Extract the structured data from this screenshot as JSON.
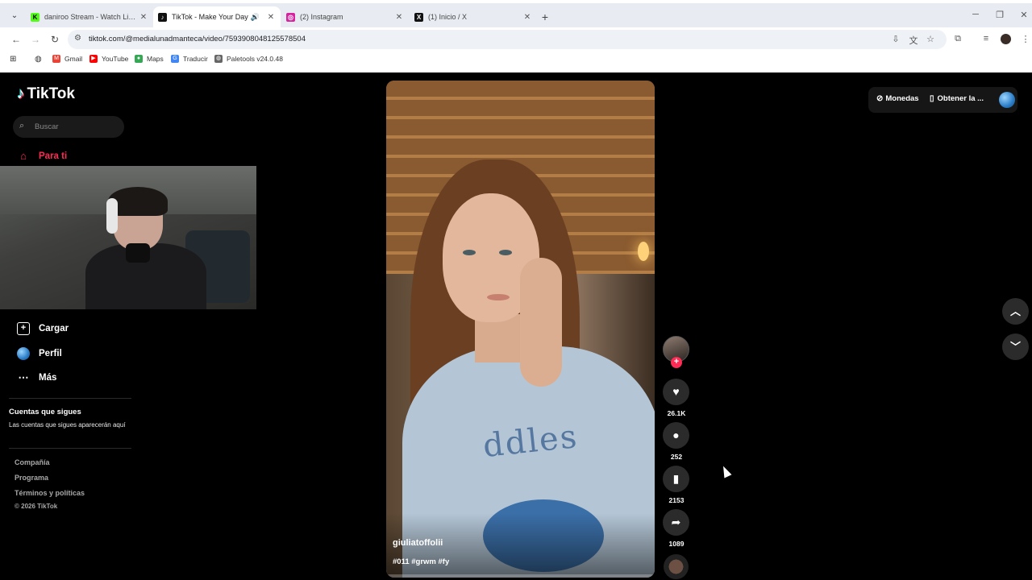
{
  "browser": {
    "tabs": [
      {
        "title": "daniroo Stream - Watch Live on",
        "favicon": "kick-icon",
        "color": "#53fc18"
      },
      {
        "title": "TikTok - Make Your Day",
        "favicon": "tiktok-icon",
        "color": "#111111"
      },
      {
        "title": "(2) Instagram",
        "favicon": "instagram-icon",
        "color": "#d6249f"
      },
      {
        "title": "(1) Inicio / X",
        "favicon": "x-icon",
        "color": "#111111"
      }
    ],
    "url": "tiktok.com/@medialunadmanteca/video/7593908048125578504",
    "bookmarks": [
      {
        "label": "Gmail",
        "icon": "gmail-icon"
      },
      {
        "label": "YouTube",
        "icon": "youtube-icon"
      },
      {
        "label": "Maps",
        "icon": "maps-icon"
      },
      {
        "label": "Traducir",
        "icon": "translate-icon"
      },
      {
        "label": "Paletools v24.0.48",
        "icon": "globe-icon"
      }
    ]
  },
  "tiktok": {
    "brand": "TikTok",
    "search_placeholder": "Buscar",
    "nav": {
      "for_you": "Para ti",
      "upload": "Cargar",
      "profile": "Perfil",
      "more": "Más"
    },
    "following": {
      "title": "Cuentas que sigues",
      "subtitle": "Las cuentas que sigues aparecerán aquí"
    },
    "footer": {
      "company": "Compañía",
      "program": "Programa",
      "terms": "Términos y políticas",
      "copyright": "© 2026 TikTok"
    },
    "top_right": {
      "coins": "Monedas",
      "get_app": "Obtener la ..."
    },
    "video": {
      "author": "giuliatoffolii",
      "tags": "#011 #grwm #fy",
      "likes": "26.1K",
      "comments": "252",
      "saves": "2153",
      "shares": "1089"
    },
    "accent_color": "#fe2c55"
  }
}
